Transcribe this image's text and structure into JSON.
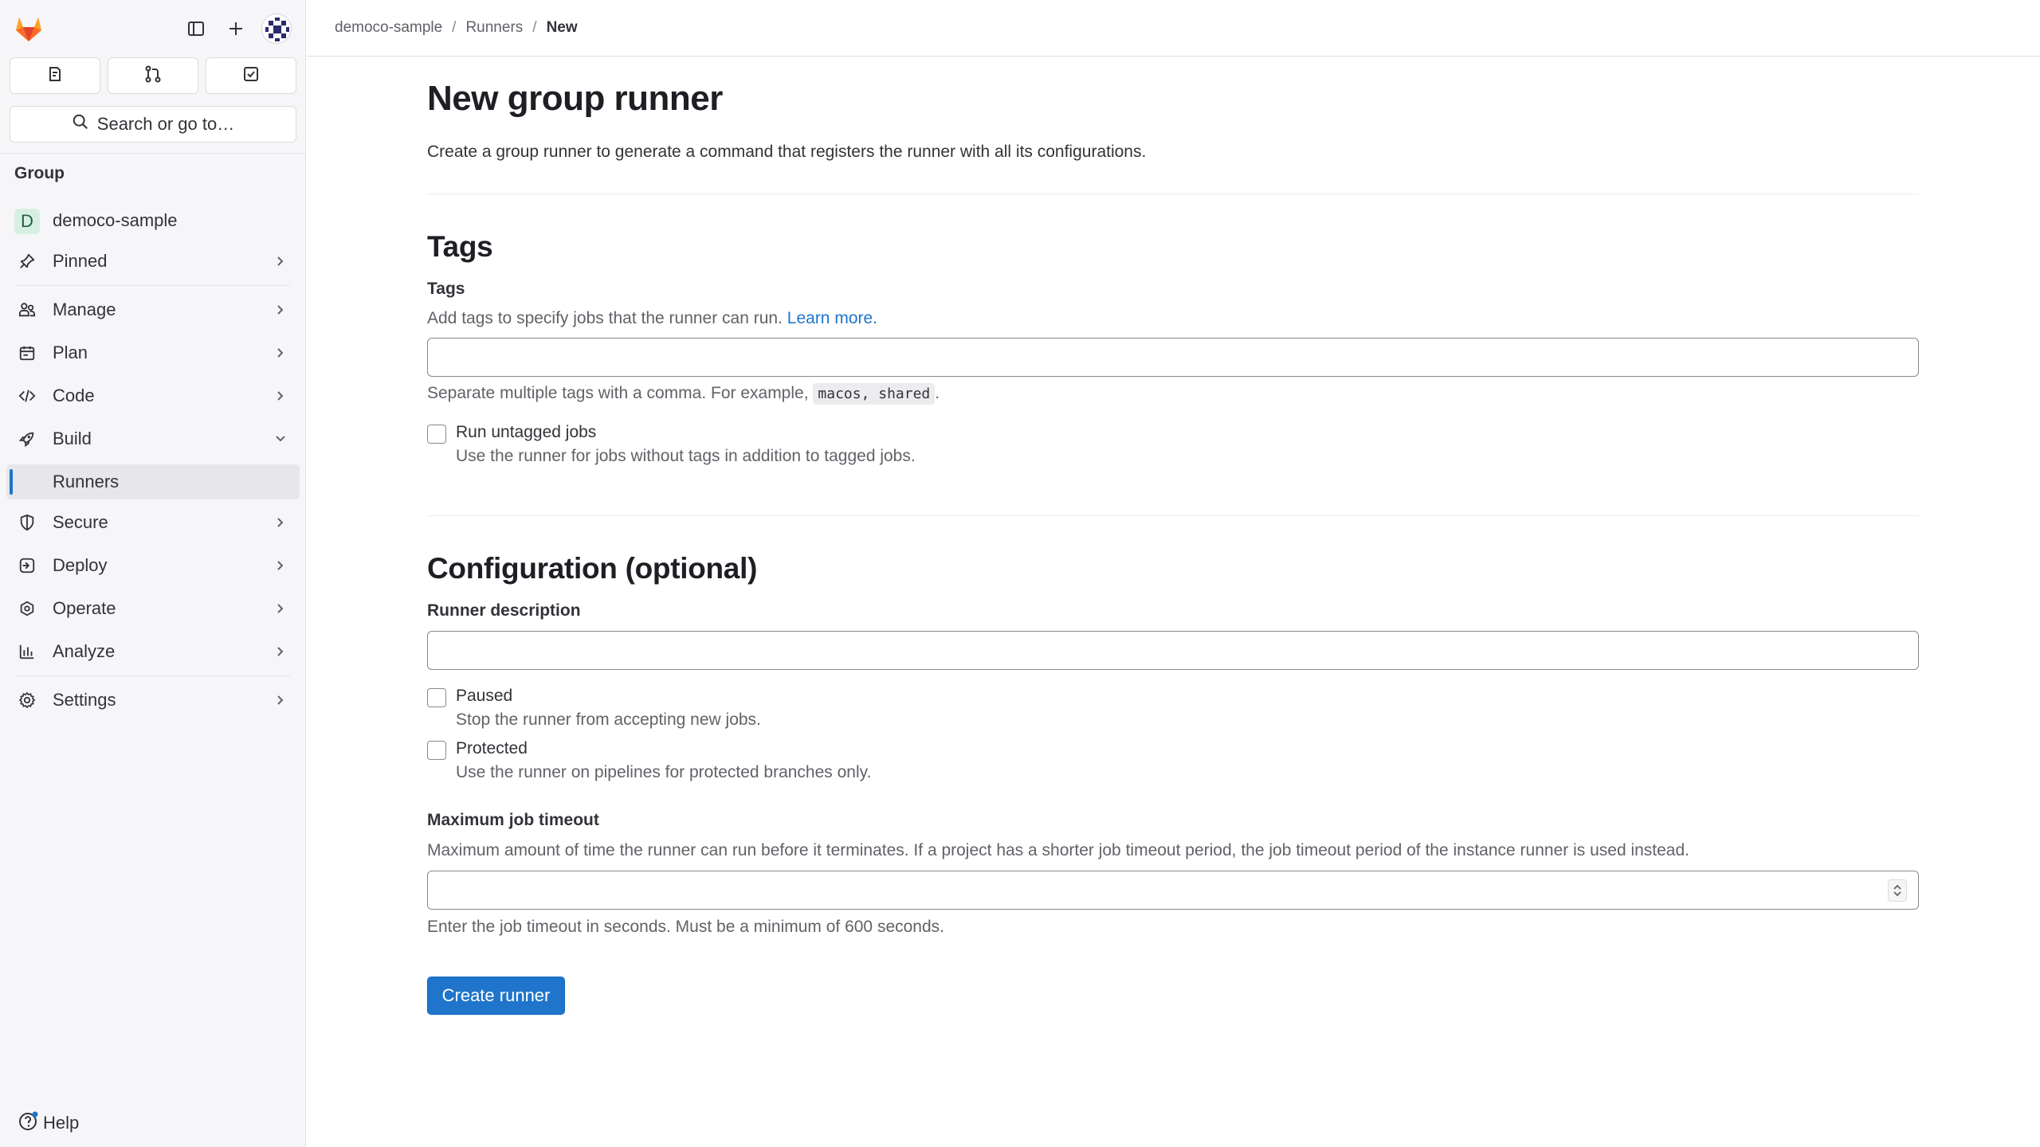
{
  "sidebar": {
    "search_placeholder": "Search or go to…",
    "group_label": "Group",
    "project": {
      "badge": "D",
      "name": "democo-sample"
    },
    "items": [
      {
        "label": "Pinned",
        "icon": "pin-icon"
      },
      {
        "label": "Manage",
        "icon": "users-icon"
      },
      {
        "label": "Plan",
        "icon": "calendar-icon"
      },
      {
        "label": "Code",
        "icon": "code-icon"
      },
      {
        "label": "Build",
        "icon": "rocket-icon",
        "expanded": true
      },
      {
        "label": "Runners",
        "active": true
      },
      {
        "label": "Secure",
        "icon": "shield-icon"
      },
      {
        "label": "Deploy",
        "icon": "deploy-icon"
      },
      {
        "label": "Operate",
        "icon": "cloud-icon"
      },
      {
        "label": "Analyze",
        "icon": "chart-icon"
      },
      {
        "label": "Settings",
        "icon": "gear-icon"
      }
    ],
    "help": "Help"
  },
  "breadcrumb": {
    "items": [
      "democo-sample",
      "Runners",
      "New"
    ],
    "separator": "/"
  },
  "main": {
    "title": "New group runner",
    "description": "Create a group runner to generate a command that registers the runner with all its configurations.",
    "tags_section": {
      "title": "Tags",
      "field_label": "Tags",
      "help_prefix": "Add tags to specify jobs that the runner can run.",
      "learn_more": "Learn more.",
      "tags_value": "",
      "separator_help_prefix": "Separate multiple tags with a comma. For example,",
      "separator_help_code": "macos, shared",
      "separator_help_suffix": ".",
      "run_untagged": {
        "label": "Run untagged jobs",
        "help": "Use the runner for jobs without tags in addition to tagged jobs.",
        "checked": false
      }
    },
    "config_section": {
      "title": "Configuration (optional)",
      "description_label": "Runner description",
      "description_value": "",
      "paused": {
        "label": "Paused",
        "help": "Stop the runner from accepting new jobs.",
        "checked": false
      },
      "protected": {
        "label": "Protected",
        "help": "Use the runner on pipelines for protected branches only.",
        "checked": false
      },
      "timeout_label": "Maximum job timeout",
      "timeout_help": "Maximum amount of time the runner can run before it terminates. If a project has a shorter job timeout period, the job timeout period of the instance runner is used instead.",
      "timeout_value": "",
      "timeout_footer": "Enter the job timeout in seconds. Must be a minimum of 600 seconds."
    },
    "submit_label": "Create runner"
  },
  "colors": {
    "primary": "#1f75cb",
    "sidebar_bg": "#f6f6f8",
    "active_indicator": "#1f75cb",
    "logo_orange": "#e24329"
  }
}
